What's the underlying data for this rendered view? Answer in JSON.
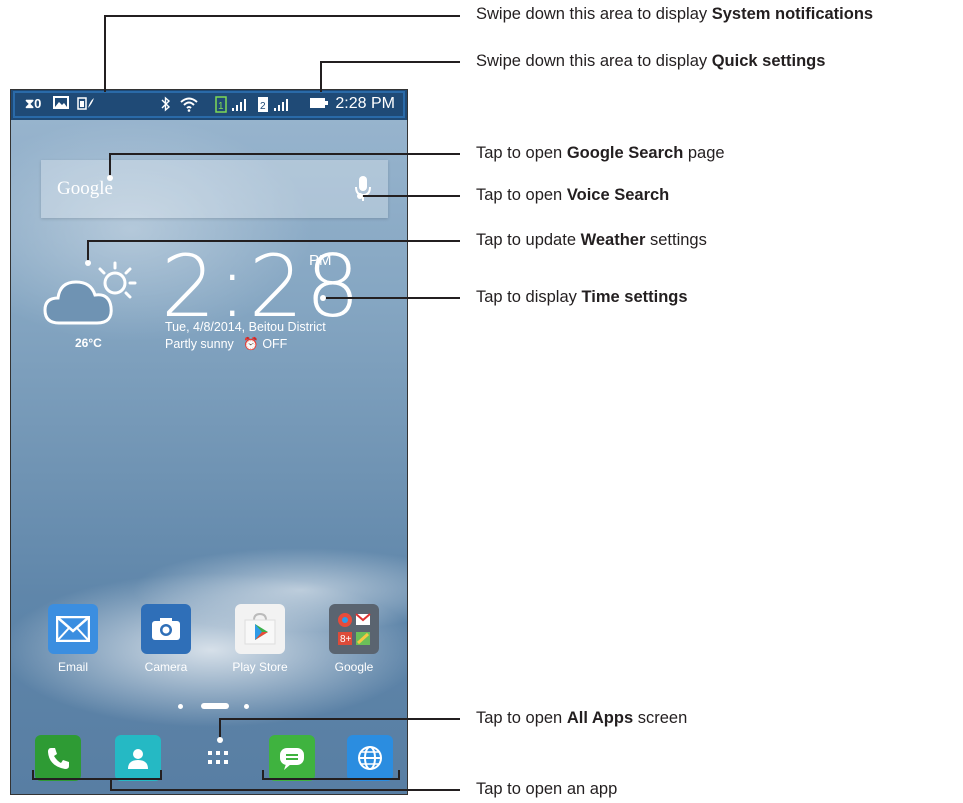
{
  "status_bar": {
    "left_icons": [
      "x0-icon",
      "image-icon",
      "battery-saver-icon"
    ],
    "right_icons": [
      "bluetooth-icon",
      "wifi-icon",
      "sim1-icon",
      "signal1-icon",
      "sim2-icon",
      "signal2-icon",
      "battery-icon"
    ],
    "time": "2:28 PM"
  },
  "search_widget": {
    "logo_text": "Google",
    "mic_icon": "microphone-icon"
  },
  "weather": {
    "temperature": "26°C",
    "icon": "partly-cloudy-icon"
  },
  "clock": {
    "time": "2:28",
    "ampm": "PM",
    "date": "Tue, 4/8/2014, Beitou District",
    "condition": "Partly sunny",
    "alarm": "OFF"
  },
  "apps": [
    {
      "label": "Email",
      "icon": "email-icon",
      "color": "#3b8ee0"
    },
    {
      "label": "Camera",
      "icon": "camera-icon",
      "color": "#2f6fb8"
    },
    {
      "label": "Play Store",
      "icon": "play-store-icon",
      "color": "#f2f2f2"
    },
    {
      "label": "Google",
      "icon": "google-folder-icon",
      "color": "#5a6470"
    }
  ],
  "dock": [
    {
      "icon": "phone-icon",
      "color": "#2e9b34"
    },
    {
      "icon": "contacts-icon",
      "color": "#25b9c4"
    },
    {
      "icon": "all-apps-icon",
      "color": "transparent"
    },
    {
      "icon": "messaging-icon",
      "color": "#3fb33f"
    },
    {
      "icon": "browser-icon",
      "color": "#2b8de0"
    }
  ],
  "callouts": [
    {
      "prefix": "Swipe down this area to display ",
      "bold": "System notifications",
      "suffix": ""
    },
    {
      "prefix": "Swipe down this area to display ",
      "bold": "Quick settings",
      "suffix": ""
    },
    {
      "prefix": "Tap to open ",
      "bold": "Google Search",
      "suffix": " page"
    },
    {
      "prefix": "Tap to open ",
      "bold": "Voice Search",
      "suffix": ""
    },
    {
      "prefix": "Tap to update ",
      "bold": "Weather",
      "suffix": " settings"
    },
    {
      "prefix": "Tap to display ",
      "bold": "Time settings",
      "suffix": ""
    },
    {
      "prefix": "Tap to open ",
      "bold": "All Apps",
      "suffix": " screen"
    },
    {
      "prefix": "Tap to open an app",
      "bold": "",
      "suffix": ""
    }
  ]
}
